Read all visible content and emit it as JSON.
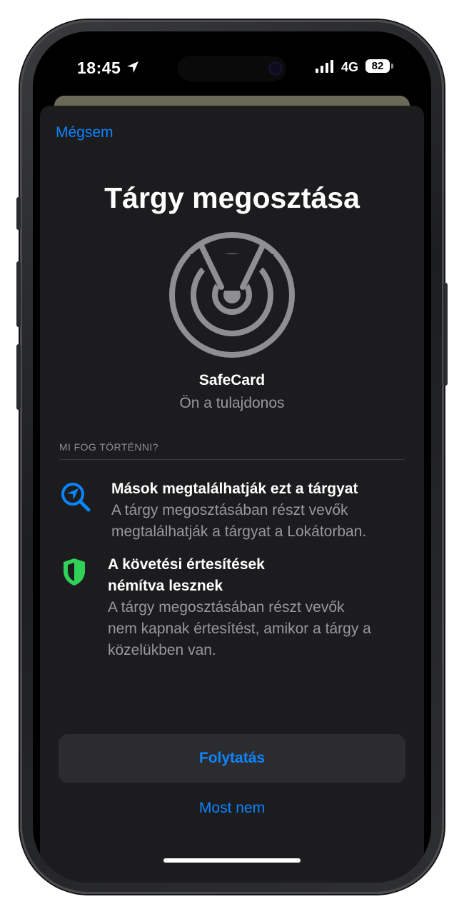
{
  "status_bar": {
    "time": "18:45",
    "network": "4G",
    "battery": "82"
  },
  "sheet": {
    "cancel_label": "Mégsem",
    "title": "Tárgy megosztása",
    "item": {
      "name": "SafeCard",
      "owner": "Ön a tulajdonos",
      "icon": "airtag-radar-icon"
    },
    "section_header": "MI FOG TÖRTÉNNI?",
    "features": [
      {
        "icon": "find-magnifier-icon",
        "icon_color": "#0a84ff",
        "title": "Mások megtalálhatják ezt a tárgyat",
        "desc_lines": [
          "A tárgy megosztásában részt vevők",
          "megtalálhatják a tárgyat a Lokátorban."
        ]
      },
      {
        "icon": "shield-icon",
        "icon_color": "#30d158",
        "title_lines": [
          "A követési értesítések",
          "némítva lesznek"
        ],
        "desc_lines": [
          "A tárgy megosztásában részt vevők",
          "nem kapnak értesítést, amikor a tárgy a",
          "közelükben van."
        ]
      }
    ],
    "primary_button": "Folytatás",
    "secondary_button": "Most nem"
  },
  "colors": {
    "accent": "#0a84ff",
    "sheet_background": "#1c1c1e",
    "secondary_text": "#98989d"
  }
}
